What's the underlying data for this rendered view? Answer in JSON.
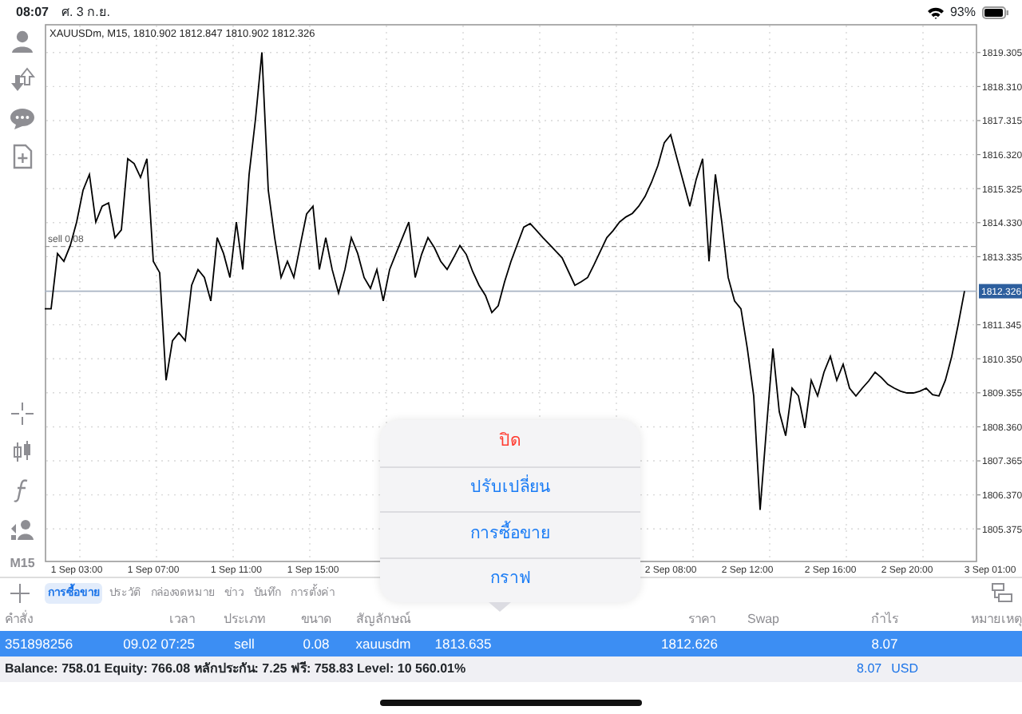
{
  "status_bar": {
    "time": "08:07",
    "date": "ศ. 3 ก.ย.",
    "battery": "93%"
  },
  "toolbar": {
    "timeframe": "M15"
  },
  "chart": {
    "chart_data": {
      "type": "line",
      "title": "XAUUSDm, M15, 1810.902 1812.847 1810.902 1812.326",
      "ylim": [
        1804.4,
        1820.14
      ],
      "categories": [
        null,
        null,
        null,
        null,
        null,
        "1 Sep 03:00",
        null,
        null,
        null,
        null,
        null,
        null,
        null,
        null,
        null,
        null,
        null,
        "1 Sep 07:00",
        null,
        null,
        null,
        null,
        null,
        null,
        null,
        null,
        null,
        null,
        null,
        null,
        "1 Sep 11:00",
        null,
        null,
        null,
        null,
        null,
        null,
        null,
        null,
        null,
        null,
        null,
        "1 Sep 15:00",
        null,
        null,
        null,
        null,
        null,
        null,
        null,
        null,
        null,
        null,
        null,
        null,
        null,
        null,
        null,
        null,
        null,
        null,
        null,
        null,
        null,
        null,
        null,
        null,
        null,
        null,
        null,
        null,
        null,
        null,
        null,
        null,
        null,
        null,
        null,
        null,
        null,
        null,
        null,
        null,
        null,
        null,
        null,
        null,
        null,
        null,
        null,
        null,
        null,
        null,
        null,
        null,
        null,
        null,
        null,
        "2 Sep 08:00",
        null,
        null,
        null,
        null,
        null,
        null,
        null,
        null,
        null,
        null,
        null,
        "2 Sep 12:00",
        null,
        null,
        null,
        null,
        null,
        null,
        null,
        null,
        null,
        null,
        null,
        null,
        "2 Sep 16:00",
        null,
        null,
        null,
        null,
        null,
        null,
        null,
        null,
        null,
        null,
        null,
        "2 Sep 20:00",
        null,
        null,
        null,
        null,
        null,
        null,
        null,
        null,
        null,
        null,
        null,
        null,
        "3 Sep 01:00"
      ],
      "yticks": [
        {
          "value": 1819.305,
          "label": "1819.305"
        },
        {
          "value": 1818.31,
          "label": "1818.310"
        },
        {
          "value": 1817.315,
          "label": "1817.315"
        },
        {
          "value": 1816.32,
          "label": "1816.320"
        },
        {
          "value": 1815.325,
          "label": "1815.325"
        },
        {
          "value": 1814.33,
          "label": "1814.330"
        },
        {
          "value": 1813.335,
          "label": "1813.335"
        },
        {
          "value": 1811.345,
          "label": "1811.345"
        },
        {
          "value": 1810.35,
          "label": "1810.350"
        },
        {
          "value": 1809.355,
          "label": "1809.355"
        },
        {
          "value": 1808.36,
          "label": "1808.360"
        },
        {
          "value": 1807.365,
          "label": "1807.365"
        },
        {
          "value": 1806.37,
          "label": "1806.370"
        },
        {
          "value": 1805.375,
          "label": "1805.375"
        }
      ],
      "series": [
        {
          "color": "#000000",
          "values": [
            1811.81,
            1811.81,
            1813.43,
            1813.2,
            1813.66,
            1814.35,
            1815.28,
            1815.74,
            1814.35,
            1814.81,
            1814.91,
            1813.89,
            1814.12,
            1816.2,
            1816.06,
            1815.65,
            1816.2,
            1813.2,
            1812.87,
            1809.72,
            1810.88,
            1811.11,
            1810.88,
            1812.5,
            1812.96,
            1812.73,
            1812.04,
            1813.89,
            1813.43,
            1812.73,
            1814.35,
            1812.96,
            1815.74,
            1817.36,
            1819.31,
            1815.28,
            1813.89,
            1812.73,
            1813.2,
            1812.73,
            1813.66,
            1814.58,
            1814.81,
            1812.96,
            1813.89,
            1812.96,
            1812.27,
            1812.96,
            1813.89,
            1813.43,
            1812.73,
            1812.41,
            1812.96,
            1812.04,
            1812.96,
            1813.43,
            1813.89,
            1814.35,
            1812.73,
            1813.4,
            1813.89,
            1813.6,
            1813.2,
            1812.96,
            1813.3,
            1813.66,
            1813.4,
            1812.9,
            1812.5,
            1812.2,
            1811.7,
            1811.9,
            1812.6,
            1813.2,
            1813.7,
            1814.2,
            1814.3,
            1814.1,
            1813.89,
            1813.7,
            1813.5,
            1813.3,
            1812.9,
            1812.5,
            1812.6,
            1812.73,
            1813.1,
            1813.5,
            1813.89,
            1814.1,
            1814.35,
            1814.5,
            1814.6,
            1814.81,
            1815.1,
            1815.51,
            1816.0,
            1816.67,
            1816.9,
            1816.2,
            1815.51,
            1814.81,
            1815.6,
            1816.2,
            1813.2,
            1815.74,
            1814.35,
            1812.73,
            1812.04,
            1811.81,
            1810.65,
            1809.26,
            1805.93,
            1808.33,
            1810.65,
            1808.8,
            1808.1,
            1809.49,
            1809.26,
            1808.33,
            1809.72,
            1809.26,
            1809.96,
            1810.42,
            1809.72,
            1810.19,
            1809.49,
            1809.26,
            1809.49,
            1809.7,
            1809.96,
            1809.8,
            1809.6,
            1809.49,
            1809.4,
            1809.35,
            1809.35,
            1809.4,
            1809.49,
            1809.3,
            1809.26,
            1809.72,
            1810.42,
            1811.34,
            1812.33,
            null,
            null,
            null,
            null
          ]
        }
      ],
      "grid": true,
      "ref_lines": [
        {
          "axis": "y",
          "value": 1813.635,
          "label": "sell 0.08"
        },
        {
          "axis": "y",
          "value": 1812.326,
          "label": "1812.326"
        }
      ]
    }
  },
  "tabs": [
    {
      "label": "การซื้อขาย",
      "selected": true
    },
    {
      "label": "ประวัติ",
      "selected": false
    },
    {
      "label": "กล่องจดหมาย",
      "selected": false
    },
    {
      "label": "ข่าว",
      "selected": false
    },
    {
      "label": "บันทึก",
      "selected": false
    },
    {
      "label": "การตั้งค่า",
      "selected": false
    }
  ],
  "table": {
    "columns": [
      "คำสั่ง",
      "เวลา",
      "ประเภท",
      "ขนาด",
      "สัญลักษณ์",
      null,
      null,
      null,
      "ราคา",
      "Swap",
      "กำไร",
      "หมายเหตุ"
    ],
    "rows": [
      {
        "selected": true,
        "cells": [
          "351898256",
          "09.02 07:25",
          "sell",
          "0.08",
          "xauusdm",
          "1813.635",
          null,
          null,
          "1812.626",
          null,
          "8.07",
          null
        ]
      }
    ]
  },
  "summary": {
    "text": "Balance: 758.01 Equity: 766.08 หลักประกัน: 7.25 ฟรี: 758.83 Level: 10 560.01%",
    "profit": "8.07",
    "currency": "USD"
  },
  "popover": {
    "items": [
      {
        "label": "ปิด",
        "kind": "destructive"
      },
      {
        "label": "ปรับเปลี่ยน",
        "kind": "action"
      },
      {
        "label": "การซื้อขาย",
        "kind": "action"
      },
      {
        "label": "กราฟ",
        "kind": "action"
      }
    ]
  }
}
